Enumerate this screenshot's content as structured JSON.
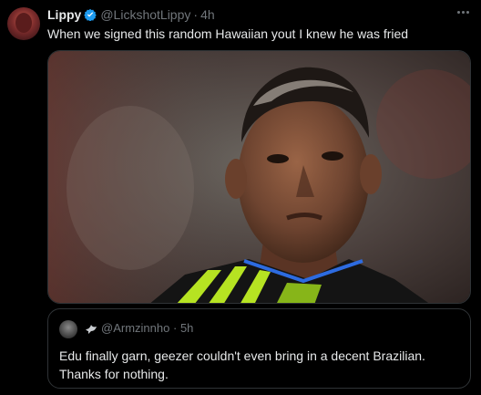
{
  "tweet": {
    "author_name": "Lippy",
    "author_handle": "@LickshotLippy",
    "separator": "·",
    "time": "4h",
    "text": "When we signed this random Hawaiian yout I knew he was fried",
    "media_alt": "Footballer in a green and black training kit looking ahead"
  },
  "quoted": {
    "handle": "@Armzinnho",
    "separator": "·",
    "time": "5h",
    "text": "Edu finally garn, geezer couldn't even bring in a decent Brazilian. Thanks for nothing."
  },
  "icons": {
    "verified": "verified-badge-icon",
    "more": "more-options-icon",
    "quoted_badge": "dove-icon"
  },
  "colors": {
    "background": "#000000",
    "text": "#e7e9ea",
    "muted": "#71767b",
    "border": "#2f3336",
    "verified": "#1d9bf0"
  }
}
